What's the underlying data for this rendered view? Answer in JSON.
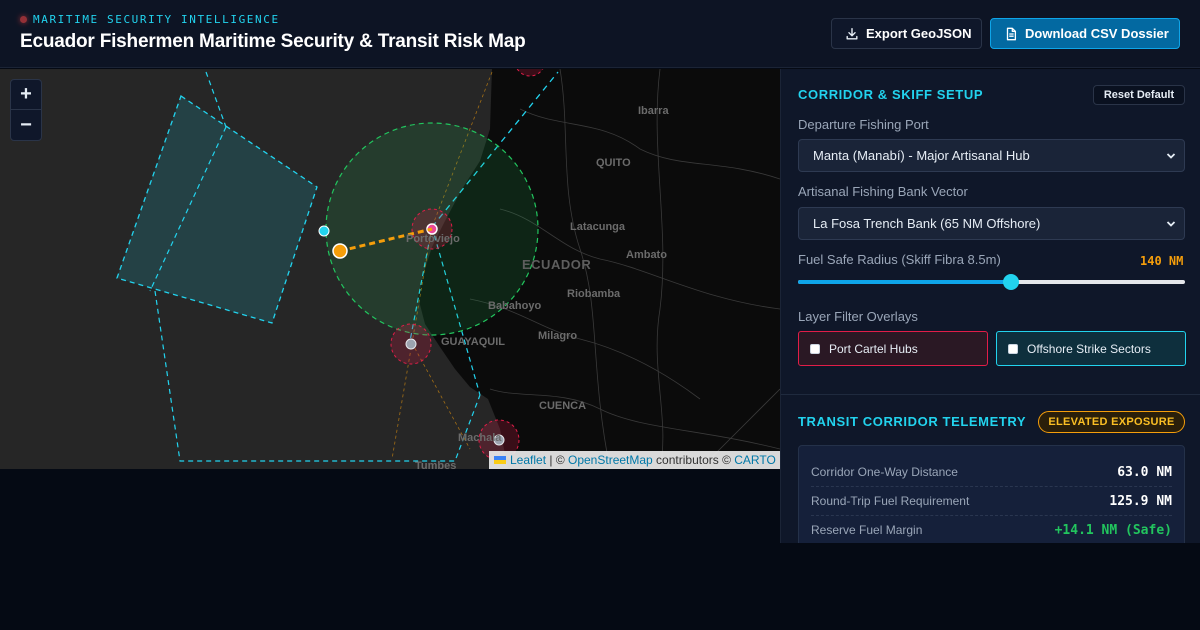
{
  "header": {
    "kicker": "MARITIME SECURITY INTELLIGENCE",
    "title": "Ecuador Fishermen Maritime Security & Transit Risk Map",
    "export_label": "Export GeoJSON",
    "csv_label": "Download CSV Dossier"
  },
  "map": {
    "zoom_in": "+",
    "zoom_out": "−",
    "labels": {
      "ibarra": "Ibarra",
      "quito": "QUITO",
      "latacunga": "Latacunga",
      "ecuador": "ECUADOR",
      "ambato": "Ambato",
      "portoviejo": "Portoviejo",
      "babahoyo": "Babahoyo",
      "riobamba": "Riobamba",
      "milagro": "Milagro",
      "guayaquil": "GUAYAQUIL",
      "cuenca": "CUENCA",
      "machala": "Machala",
      "tumbes": "Tumbes"
    },
    "attribution": {
      "leaflet": "Leaflet",
      "sep": " | © ",
      "osm": "OpenStreetMap",
      "contrib": " contributors © ",
      "carto": "CARTO"
    },
    "colors": {
      "strike_sector": "#22d3ee",
      "fuel_radius": "#22c55e",
      "route": "#f59e0b",
      "cartel_hub": "#e11d48"
    }
  },
  "setup": {
    "title": "CORRIDOR & SKIFF SETUP",
    "reset_label": "Reset Default",
    "port_label": "Departure Fishing Port",
    "port_value": "Manta (Manabí) - Major Artisanal Hub",
    "bank_label": "Artisanal Fishing Bank Vector",
    "bank_value": "La Fosa Trench Bank (65 NM Offshore)",
    "fuel_label": "Fuel Safe Radius (Skiff Fibra 8.5m)",
    "fuel_value": "140 NM",
    "fuel_fraction": 0.55,
    "overlays_label": "Layer Filter Overlays",
    "overlay_cartel": "Port Cartel Hubs",
    "overlay_strike": "Offshore Strike Sectors"
  },
  "telemetry": {
    "title": "TRANSIT CORRIDOR TELEMETRY",
    "badge": "ELEVATED EXPOSURE",
    "rows": [
      {
        "key": "Corridor One-Way Distance",
        "value": "63.0 NM"
      },
      {
        "key": "Round-Trip Fuel Requirement",
        "value": "125.9 NM"
      },
      {
        "key": "Reserve Fuel Margin",
        "value": "+14.1 NM (Safe)"
      }
    ]
  }
}
